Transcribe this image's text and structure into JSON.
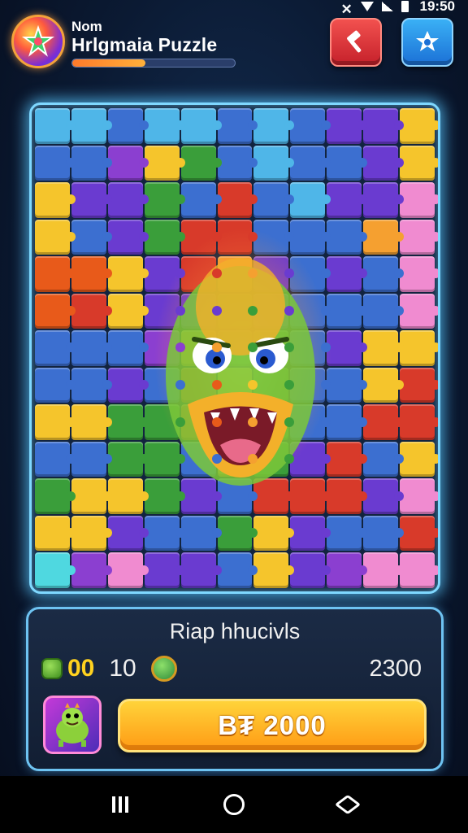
{
  "status_bar": {
    "time": "19:50"
  },
  "header": {
    "title_small": "Nom",
    "title_main": "Hrlgmaia Puzzle",
    "progress": 0.45,
    "icons": {
      "logo": "puzzle-star-logo",
      "hammer": "hammer-icon",
      "settings": "star-gear-icon"
    }
  },
  "board": {
    "columns": 11,
    "rows": 13,
    "pieces": [
      "#4fb6e8",
      "#4fb6e8",
      "#3c6fd0",
      "#4fb6e8",
      "#4fb6e8",
      "#3c6fd0",
      "#4fb6e8",
      "#3c6fd0",
      "#6a3bd0",
      "#6a3bd0",
      "#f5c52c",
      "#3c6fd0",
      "#3c6fd0",
      "#8b3fd0",
      "#f5c52c",
      "#3a9e3a",
      "#3c6fd0",
      "#4fb6e8",
      "#3c6fd0",
      "#3c6fd0",
      "#6a3bd0",
      "#f5c52c",
      "#f5c52c",
      "#6a3bd0",
      "#6a3bd0",
      "#3a9e3a",
      "#3c6fd0",
      "#d83a2a",
      "#3c6fd0",
      "#4fb6e8",
      "#6a3bd0",
      "#6a3bd0",
      "#f08bd0",
      "#f5c52c",
      "#3c6fd0",
      "#6a3bd0",
      "#3a9e3a",
      "#d83a2a",
      "#d83a2a",
      "#3c6fd0",
      "#3c6fd0",
      "#3c6fd0",
      "#f5a030",
      "#f08bd0",
      "#e85a1a",
      "#e85a1a",
      "#f5c52c",
      "#6a3bd0",
      "#d83a2a",
      "#f5a030",
      "#6a3bd0",
      "#3c6fd0",
      "#6a3bd0",
      "#3c6fd0",
      "#f08bd0",
      "#e85a1a",
      "#d83a2a",
      "#f5c52c",
      "#6a3bd0",
      "#6a3bd0",
      "#3a9e3a",
      "#6a3bd0",
      "#3c6fd0",
      "#3c6fd0",
      "#3c6fd0",
      "#f08bd0",
      "#3c6fd0",
      "#3c6fd0",
      "#3c6fd0",
      "#8b3fd0",
      "#f5a030",
      "#3a9e3a",
      "#3a9e3a",
      "#3c6fd0",
      "#6a3bd0",
      "#f5c52c",
      "#f5c52c",
      "#3c6fd0",
      "#3c6fd0",
      "#6a3bd0",
      "#3c6fd0",
      "#e85a1a",
      "#f5c52c",
      "#3a9e3a",
      "#3c6fd0",
      "#3c6fd0",
      "#f5c52c",
      "#d83a2a",
      "#f5c52c",
      "#f5c52c",
      "#3a9e3a",
      "#3a9e3a",
      "#e85a1a",
      "#f5a030",
      "#3a9e3a",
      "#3c6fd0",
      "#3c6fd0",
      "#d83a2a",
      "#d83a2a",
      "#3c6fd0",
      "#3c6fd0",
      "#3a9e3a",
      "#3a9e3a",
      "#3c6fd0",
      "#f5a030",
      "#3a9e3a",
      "#6a3bd0",
      "#d83a2a",
      "#3c6fd0",
      "#f5c52c",
      "#3a9e3a",
      "#f5c52c",
      "#f5c52c",
      "#3a9e3a",
      "#6a3bd0",
      "#3c6fd0",
      "#d83a2a",
      "#d83a2a",
      "#d83a2a",
      "#6a3bd0",
      "#f08bd0",
      "#f5c52c",
      "#f5c52c",
      "#6a3bd0",
      "#3c6fd0",
      "#3c6fd0",
      "#3a9e3a",
      "#f5c52c",
      "#6a3bd0",
      "#3c6fd0",
      "#3c6fd0",
      "#d83a2a",
      "#4fd8e0",
      "#8b3fd0",
      "#f08bd0",
      "#6a3bd0",
      "#6a3bd0",
      "#3c6fd0",
      "#f5c52c",
      "#6a3bd0",
      "#8b3fd0",
      "#f08bd0",
      "#f08bd0"
    ]
  },
  "panel": {
    "title": "Riap hhucivls",
    "gold_value": "00",
    "count_value": "10",
    "score_value": "2300",
    "play_label": "B₮ 2000",
    "icons": {
      "gold": "dino-head-icon",
      "coin": "green-coin-icon",
      "avatar": "dino-avatar-icon"
    }
  },
  "navbar": {
    "icons": [
      "recents-icon",
      "home-icon",
      "back-icon"
    ]
  }
}
